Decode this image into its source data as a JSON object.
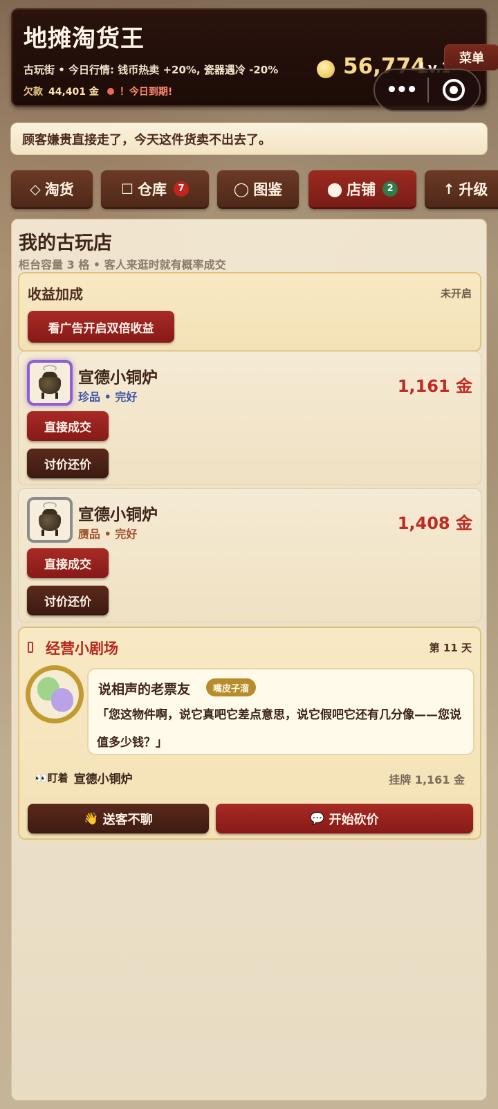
{
  "app": {
    "title": "地摊淘货王",
    "market": "古玩街 • 今日行情: 钱币热卖 +20%, 瓷器遇冷 -20%",
    "debt_label": "欠款",
    "debt_amount": "44,401 金",
    "due_text": "！今日到期!",
    "coins": "56,774",
    "level": "Lv.1",
    "menu_label": "菜单"
  },
  "capsule": {
    "more_label": "•••",
    "close_icon": "target-icon"
  },
  "notice": "顾客嫌贵直接走了，今天这件货卖不出去了。",
  "tabs": [
    {
      "icon": "◇",
      "label": "淘货",
      "badge": ""
    },
    {
      "icon": "☐",
      "label": "仓库",
      "badge": "7"
    },
    {
      "icon": "◯",
      "label": "图鉴",
      "badge": ""
    },
    {
      "icon": "⬤",
      "label": "店铺",
      "badge": "2",
      "active": true
    },
    {
      "icon": "↑",
      "label": "升级",
      "badge": ""
    }
  ],
  "shop": {
    "title": "我的古玩店",
    "subtitle": "柜台容量 3 格 • 客人来逛时就有概率成交",
    "bonus": {
      "title": "收益加成",
      "status": "未开启",
      "ad_button": "看广告开启双倍收益"
    },
    "items": [
      {
        "name": "宣德小铜炉",
        "meta": "珍品 • 完好",
        "price": "1,161 金",
        "deal": "直接成交",
        "haggle": "讨价还价",
        "grade": "rare"
      },
      {
        "name": "宣德小铜炉",
        "meta": "赝品 • 完好",
        "price": "1,408 金",
        "deal": "直接成交",
        "haggle": "讨价还价",
        "grade": "fake"
      }
    ]
  },
  "theater": {
    "title": "经营小剧场",
    "day": "第 11 天",
    "speaker": "说相声的老票友",
    "speaker_tag": "嘴皮子溜",
    "quote": "「您这物件啊，说它真吧它差点意思，说它假吧它还有几分像——您说值多少钱？」",
    "eyeing_label": "👀盯着",
    "eyeing_item": "宣德小铜炉",
    "listing": "挂牌 1,161 金",
    "dismiss_button": "送客不聊",
    "bargain_button": "开始砍价"
  }
}
